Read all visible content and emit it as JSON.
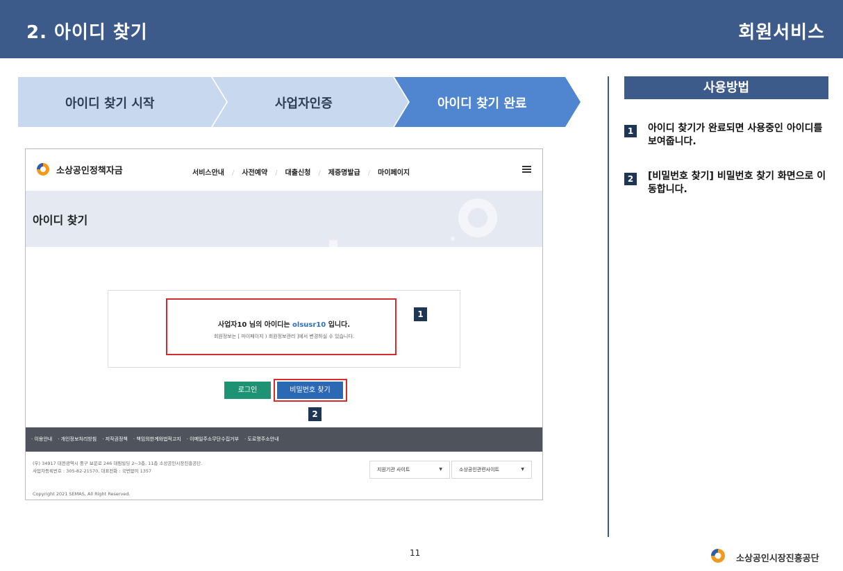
{
  "header": {
    "title": "2. 아이디 찾기",
    "section": "회원서비스"
  },
  "steps": [
    {
      "label": "아이디 찾기 시작",
      "active": false
    },
    {
      "label": "사업자인증",
      "active": false
    },
    {
      "label": "아이디 찾기 완료",
      "active": true
    }
  ],
  "howto": {
    "title": "사용방법",
    "items": [
      {
        "num": "1",
        "text": "아이디 찾기가 완료되면 사용중인 아이디를 보여줍니다."
      },
      {
        "num": "2",
        "text": "[비밀번호 찾기] 비밀번호 찾기 화면으로 이동합니다."
      }
    ]
  },
  "screenshot": {
    "logo": "소상공인정책자금",
    "menu": [
      "서비스안내",
      "사전예약",
      "대출신청",
      "제증명발급",
      "마이페이지"
    ],
    "page_title": "아이디 찾기",
    "result": {
      "prefix": "사업자10 님의 아이디는 ",
      "user_id": "olsusr10",
      "suffix": " 입니다.",
      "sub": "회원정보는 [ 마이페이지 ) 회원정보관리 ]에서 변경하실 수 있습니다."
    },
    "buttons": {
      "login": "로그인",
      "find_password": "비밀번호 찾기"
    },
    "callouts": [
      "1",
      "2"
    ],
    "footer_links": [
      "· 이용안내",
      "· 개인정보처리방침",
      "· 저작권정책",
      "· 책임의한계와법적고지",
      "· 이메일주소무단수집거부",
      "· 도로명주소안내"
    ],
    "address": "(우) 34917 대전광역시 중구 보문로 246 대림빌딩 2~3층, 11층 소상공인시장진흥공단.",
    "biz_info": "사업자등록번호 : 305-82-21570, 대표전화 : 국번없이 1357",
    "copyright": "Copyright 2021 SEMAS, All Right Reserved.",
    "selects": [
      "지원기관 사이트",
      "소상공인관련사이트"
    ]
  },
  "page_number": "11",
  "brand": "소상공인시장진흥공단",
  "colors": {
    "header": "#3c5a8a",
    "step_inactive": "#c8d8ee",
    "step_active": "#4f86cf",
    "highlight": "#d62b2b",
    "login_btn": "#1e9373",
    "pw_btn": "#2c69b5"
  }
}
